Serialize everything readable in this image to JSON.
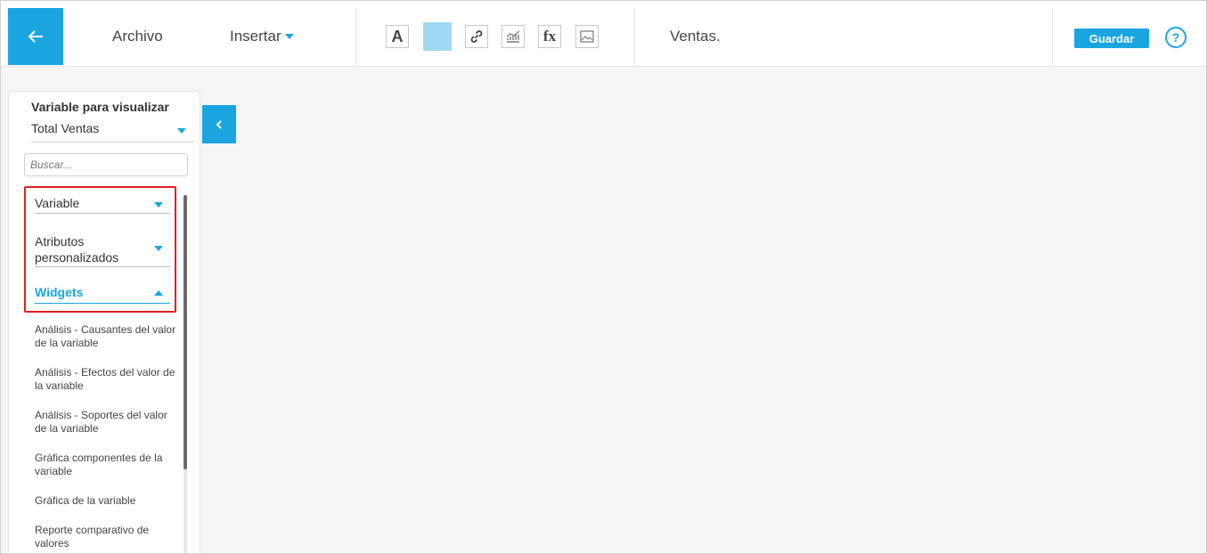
{
  "header": {
    "menu_archivo": "Archivo",
    "menu_insertar": "Insertar",
    "document_title": "Ventas.",
    "save_label": "Guardar",
    "help_label": "?",
    "text_tool": "A",
    "formula_tool": "fx"
  },
  "panel": {
    "title": "Variable para visualizar",
    "selected_variable": "Total Ventas",
    "search_placeholder": "Buscar...",
    "sections": [
      {
        "label": "Variable"
      },
      {
        "label": "Atributos personalizados"
      },
      {
        "label": "Widgets"
      }
    ],
    "widgets": [
      "Análisis - Causantes del valor de la variable",
      "Análisis - Efectos del valor de la variable",
      "Análisis - Soportes del valor de la variable",
      "Gráfica componentes de la variable",
      "Gráfica de la variable",
      "Reporte comparativo de valores"
    ]
  },
  "colors": {
    "accent": "#1aa5e0",
    "highlight": "#e02020",
    "color_swatch": "#9fd9f3"
  },
  "icons": [
    "back-arrow-icon",
    "text-icon",
    "color-swatch",
    "link-icon",
    "chart-icon",
    "formula-icon",
    "image-icon",
    "help-icon",
    "chevron-left-icon"
  ]
}
